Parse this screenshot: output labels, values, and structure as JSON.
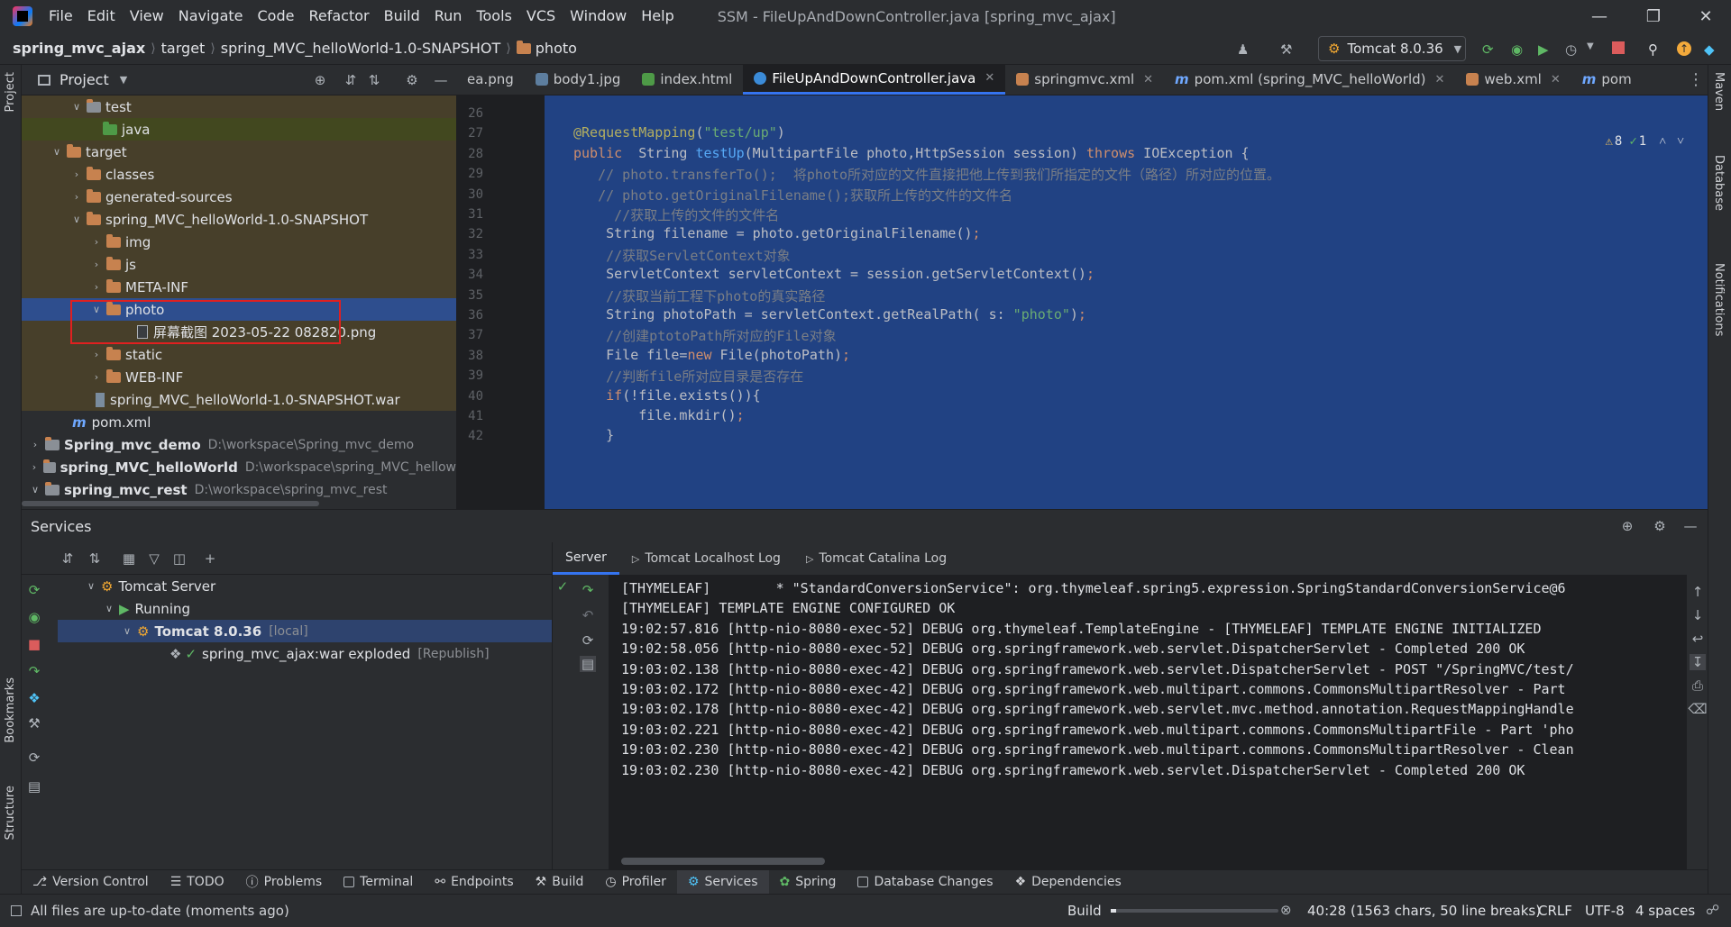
{
  "menubar": {
    "items": [
      "File",
      "Edit",
      "View",
      "Navigate",
      "Code",
      "Refactor",
      "Build",
      "Run",
      "Tools",
      "VCS",
      "Window",
      "Help"
    ],
    "title": "SSM - FileUpAndDownController.java [spring_mvc_ajax]"
  },
  "breadcrumb": [
    "spring_mvc_ajax",
    "target",
    "spring_MVC_helloWorld-1.0-SNAPSHOT",
    "photo"
  ],
  "toolbar": {
    "run_config": "Tomcat 8.0.36"
  },
  "project": {
    "header": "Project",
    "rows": [
      {
        "label": "test",
        "hint": ""
      },
      {
        "label": "java",
        "hint": ""
      },
      {
        "label": "target",
        "hint": ""
      },
      {
        "label": "classes",
        "hint": ""
      },
      {
        "label": "generated-sources",
        "hint": ""
      },
      {
        "label": "spring_MVC_helloWorld-1.0-SNAPSHOT",
        "hint": ""
      },
      {
        "label": "img",
        "hint": ""
      },
      {
        "label": "js",
        "hint": ""
      },
      {
        "label": "META-INF",
        "hint": ""
      },
      {
        "label": "photo",
        "hint": ""
      },
      {
        "label": "屏幕截图 2023-05-22 082820.png",
        "hint": ""
      },
      {
        "label": "static",
        "hint": ""
      },
      {
        "label": "WEB-INF",
        "hint": ""
      },
      {
        "label": "spring_MVC_helloWorld-1.0-SNAPSHOT.war",
        "hint": ""
      },
      {
        "label": "pom.xml",
        "hint": ""
      },
      {
        "label": "Spring_mvc_demo",
        "hint": "D:\\workspace\\Spring_mvc_demo"
      },
      {
        "label": "spring_MVC_helloWorld",
        "hint": "D:\\workspace\\spring_MVC_hellow"
      },
      {
        "label": "spring_mvc_rest",
        "hint": "D:\\workspace\\spring_mvc_rest"
      }
    ]
  },
  "editor": {
    "tabs": [
      "ea.png",
      "body1.jpg",
      "index.html",
      "FileUpAndDownController.java",
      "springmvc.xml",
      "pom.xml (spring_MVC_helloWorld)",
      "web.xml",
      "pom"
    ],
    "warnings": "8",
    "weak_warnings": "1",
    "line_numbers": [
      "26",
      "27",
      "28",
      "29",
      "30",
      "31",
      "32",
      "33",
      "34",
      "35",
      "36",
      "37",
      "38",
      "39",
      "40",
      "41",
      "42"
    ],
    "lines": [
      {
        "t": ""
      },
      {
        "t": "@RequestMapping(\"test/up\")"
      },
      {
        "t": "public  String testUp(MultipartFile photo,HttpSession session) throws IOException {"
      },
      {
        "t": "   // photo.transferTo();  将photo所对应的文件直接把他上传到我们所指定的文件（路径）所对应的位置。"
      },
      {
        "t": "   // photo.getOriginalFilename();获取所上传的文件的文件名"
      },
      {
        "t": "     //获取上传的文件的文件名"
      },
      {
        "t": "    String filename = photo.getOriginalFilename();"
      },
      {
        "t": "    //获取ServletContext对象"
      },
      {
        "t": "    ServletContext servletContext = session.getServletContext();"
      },
      {
        "t": "    //获取当前工程下photo的真实路径"
      },
      {
        "t": "    String photoPath = servletContext.getRealPath( s: \"photo\");"
      },
      {
        "t": "    //创建ptotoPath所对应的File对象"
      },
      {
        "t": "    File file=new File(photoPath);"
      },
      {
        "t": "    //判断file所对应目录是否存在"
      },
      {
        "t": "    if(!file.exists()){"
      },
      {
        "t": "        file.mkdir();"
      },
      {
        "t": "    }"
      }
    ]
  },
  "services": {
    "title": "Services",
    "tree": [
      {
        "label": "Tomcat Server",
        "hint": ""
      },
      {
        "label": "Running",
        "hint": ""
      },
      {
        "label": "Tomcat 8.0.36",
        "hint": "[local]"
      },
      {
        "label": "spring_mvc_ajax:war exploded",
        "hint": "[Republish]"
      }
    ],
    "console_tabs": [
      "Server",
      "Tomcat Localhost Log",
      "Tomcat Catalina Log"
    ],
    "log": [
      "[THYMELEAF]        * \"StandardConversionService\": org.thymeleaf.spring5.expression.SpringStandardConversionService@6",
      "[THYMELEAF] TEMPLATE ENGINE CONFIGURED OK",
      "19:02:57.816 [http-nio-8080-exec-52] DEBUG org.thymeleaf.TemplateEngine - [THYMELEAF] TEMPLATE ENGINE INITIALIZED",
      "19:02:58.056 [http-nio-8080-exec-52] DEBUG org.springframework.web.servlet.DispatcherServlet - Completed 200 OK",
      "19:03:02.138 [http-nio-8080-exec-42] DEBUG org.springframework.web.servlet.DispatcherServlet - POST \"/SpringMVC/test/",
      "19:03:02.172 [http-nio-8080-exec-42] DEBUG org.springframework.web.multipart.commons.CommonsMultipartResolver - Part",
      "19:03:02.178 [http-nio-8080-exec-42] DEBUG org.springframework.web.servlet.mvc.method.annotation.RequestMappingHandle",
      "19:03:02.221 [http-nio-8080-exec-42] DEBUG org.springframework.web.multipart.commons.CommonsMultipartFile - Part 'pho",
      "19:03:02.230 [http-nio-8080-exec-42] DEBUG org.springframework.web.multipart.commons.CommonsMultipartResolver - Clean",
      "19:03:02.230 [http-nio-8080-exec-42] DEBUG org.springframework.web.servlet.DispatcherServlet - Completed 200 OK"
    ]
  },
  "bottom_tabs": [
    "Version Control",
    "TODO",
    "Problems",
    "Terminal",
    "Endpoints",
    "Build",
    "Profiler",
    "Services",
    "Spring",
    "Database Changes",
    "Dependencies"
  ],
  "left_strip": [
    "Project",
    "Bookmarks",
    "Structure"
  ],
  "right_strip": [
    "Maven",
    "Database",
    "Notifications"
  ],
  "status": {
    "message": "All files are up-to-date (moments ago)",
    "build": "Build",
    "position": "40:28 (1563 chars, 50 line breaks)",
    "line_sep": "CRLF",
    "encoding": "UTF-8",
    "indent": "4 spaces"
  }
}
